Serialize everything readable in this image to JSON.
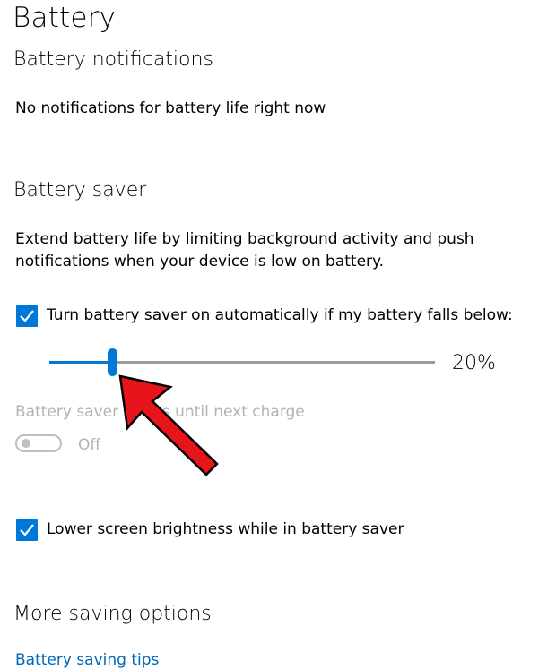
{
  "page": {
    "title": "Battery"
  },
  "notifications": {
    "heading": "Battery notifications",
    "message": "No notifications for battery life right now"
  },
  "battery_saver": {
    "heading": "Battery saver",
    "description_line1": "Extend battery life by limiting background activity and push",
    "description_line2": "notifications when your device is low on battery.",
    "auto_checkbox_label": "Turn battery saver on automatically if my battery falls below:",
    "auto_checkbox_checked": true,
    "threshold_value_label": "20%",
    "threshold_percent": 20,
    "status_label": "Battery saver status until next charge",
    "status_toggle_state": "Off",
    "brightness_checkbox_label": "Lower screen brightness while in battery saver",
    "brightness_checkbox_checked": true
  },
  "more_options": {
    "heading": "More saving options",
    "tips_link": "Battery saving tips"
  },
  "colors": {
    "accent": "#0078d7",
    "link": "#0067b8",
    "disabled_text": "#b3b3b3",
    "annotation_arrow": "#e8141b"
  },
  "icons": {
    "checkmark": "checkmark-icon",
    "annotation": "red-arrow-icon"
  }
}
